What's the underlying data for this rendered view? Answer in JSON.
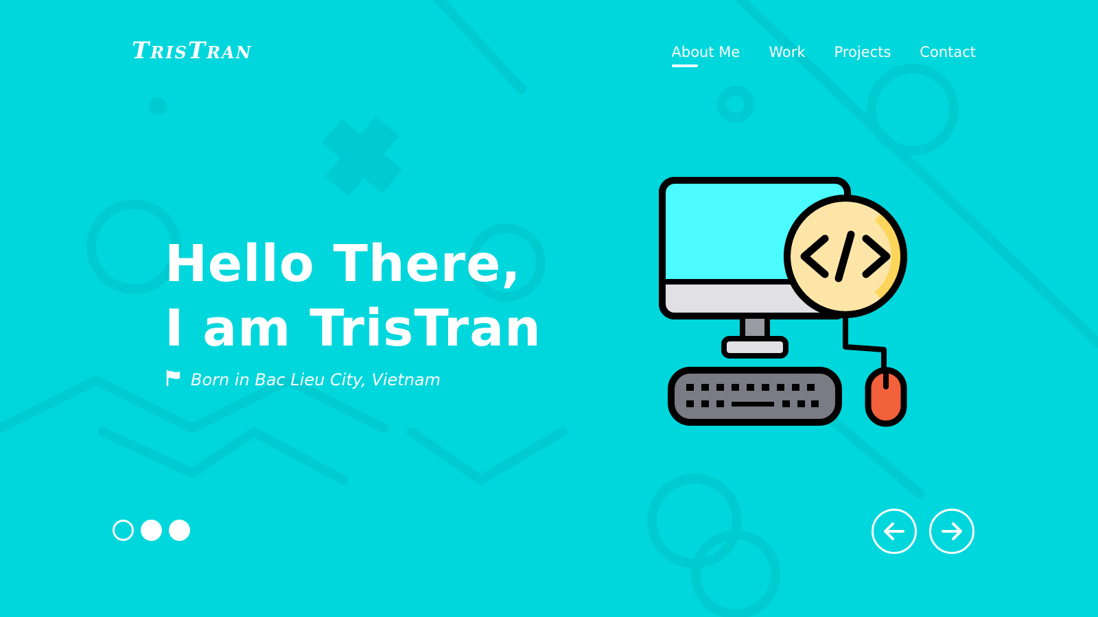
{
  "brand": {
    "logo": "TrisTran"
  },
  "nav": {
    "items": [
      {
        "label": "About Me",
        "active": true
      },
      {
        "label": "Work",
        "active": false
      },
      {
        "label": "Projects",
        "active": false
      },
      {
        "label": "Contact",
        "active": false
      }
    ]
  },
  "hero": {
    "title_line1": "Hello There,",
    "title_line2": "I am TrisTran",
    "subtitle": "Born in Bac Lieu City, Vietnam",
    "subtitle_icon": "flag-icon",
    "illustration_icon": "computer-code-icon"
  },
  "carousel": {
    "indicator_count": 3,
    "active_index": 0,
    "prev_icon": "arrow-left-icon",
    "next_icon": "arrow-right-icon"
  },
  "colors": {
    "background": "#00d7dc",
    "text": "#ffffff",
    "screen": "#4bfbff",
    "code_badge": "#fde5a8",
    "mouse": "#f2613c"
  }
}
